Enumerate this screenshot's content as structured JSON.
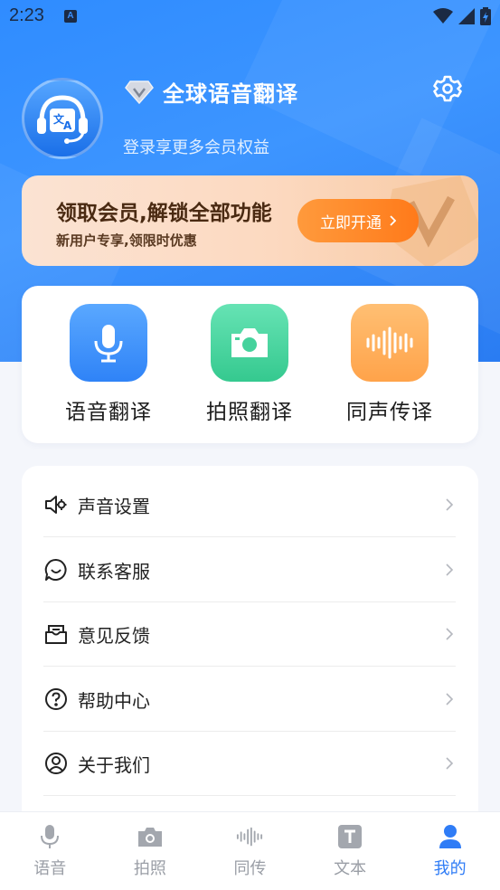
{
  "status_bar": {
    "time": "2:23",
    "notification_icon": "A"
  },
  "header": {
    "app_title": "全球语音翻译",
    "subtitle": "登录享更多会员权益",
    "avatar_icon": "translator-headset-icon",
    "settings_icon": "gear-icon"
  },
  "vip_banner": {
    "title": "领取会员,解锁全部功能",
    "subtitle": "新用户专享,领限时优惠",
    "button_label": "立即开通"
  },
  "quick_actions": [
    {
      "label": "语音翻译",
      "icon": "microphone-icon",
      "color": "#3d95ff"
    },
    {
      "label": "拍照翻译",
      "icon": "camera-icon",
      "color": "#3fd49b"
    },
    {
      "label": "同声传译",
      "icon": "soundwave-icon",
      "color": "#ffa64d"
    }
  ],
  "menu": [
    {
      "label": "声音设置",
      "icon": "speaker-settings-icon"
    },
    {
      "label": "联系客服",
      "icon": "customer-service-icon"
    },
    {
      "label": "意见反馈",
      "icon": "feedback-icon"
    },
    {
      "label": "帮助中心",
      "icon": "help-icon"
    },
    {
      "label": "关于我们",
      "icon": "about-icon"
    }
  ],
  "tabbar": [
    {
      "label": "语音",
      "icon": "microphone-icon",
      "active": false
    },
    {
      "label": "拍照",
      "icon": "camera-icon",
      "active": false
    },
    {
      "label": "同传",
      "icon": "soundwave-icon",
      "active": false
    },
    {
      "label": "文本",
      "icon": "text-icon",
      "active": false
    },
    {
      "label": "我的",
      "icon": "profile-icon",
      "active": true
    }
  ],
  "colors": {
    "primary": "#2f7cf6",
    "vip_button": "#ff8a2a",
    "inactive_tab": "#9a9ea6"
  }
}
